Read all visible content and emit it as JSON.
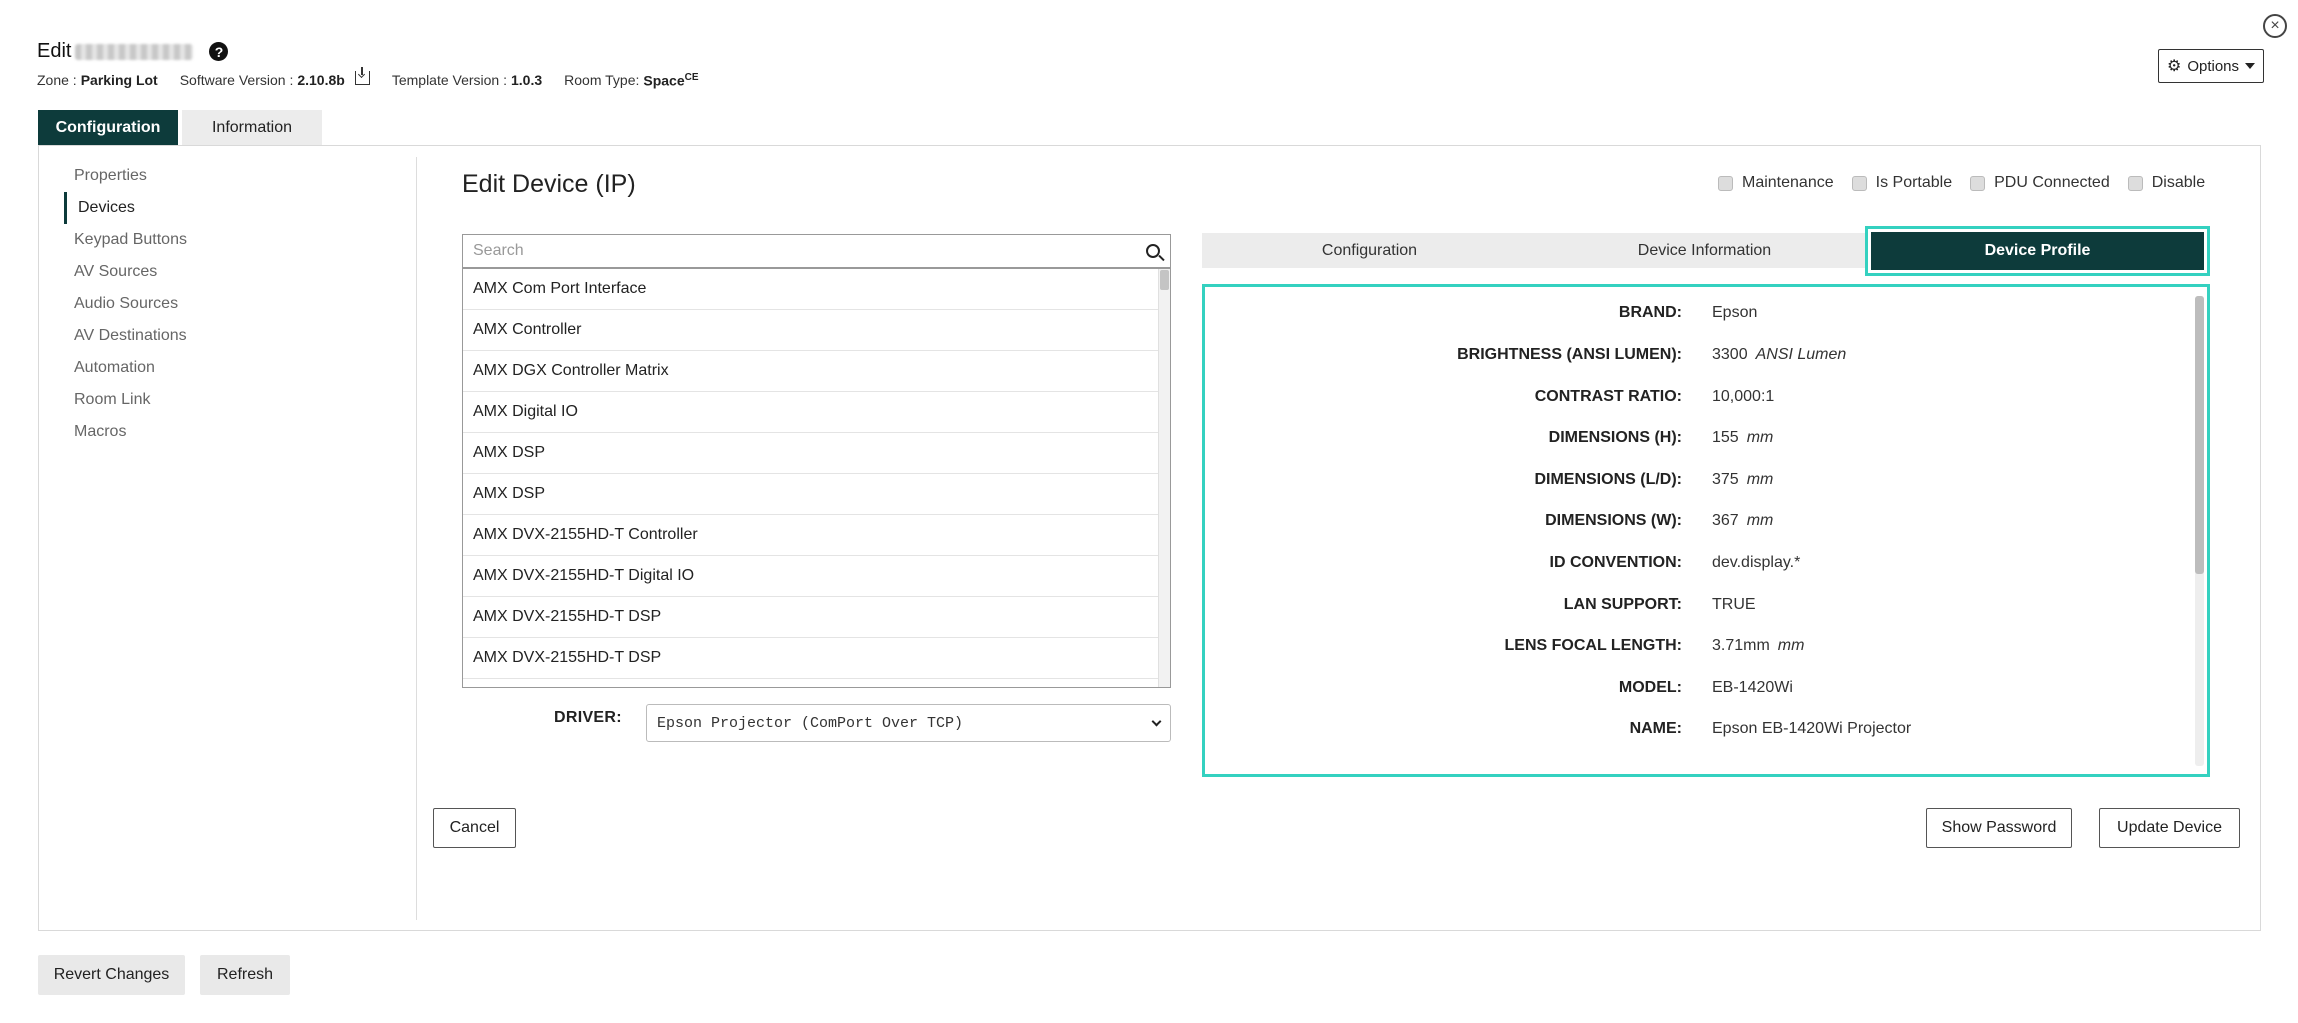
{
  "header": {
    "edit_prefix": "Edit",
    "help_icon": "?",
    "zone_label": "Zone :",
    "zone_value": "Parking Lot",
    "software_label": "Software Version :",
    "software_value": "2.10.8b",
    "template_label": "Template Version :",
    "template_value": "1.0.3",
    "roomtype_label": "Room Type:",
    "roomtype_value": "Space",
    "roomtype_sup": "CE",
    "close_icon": "×"
  },
  "options": {
    "label": "Options",
    "icon": "gear-icon"
  },
  "tabs": [
    {
      "label": "Configuration",
      "active": true
    },
    {
      "label": "Information",
      "active": false
    }
  ],
  "sidebar": {
    "items": [
      {
        "label": "Properties"
      },
      {
        "label": "Devices",
        "active": true
      },
      {
        "label": "Keypad Buttons"
      },
      {
        "label": "AV Sources"
      },
      {
        "label": "Audio Sources"
      },
      {
        "label": "AV Destinations"
      },
      {
        "label": "Automation"
      },
      {
        "label": "Room Link"
      },
      {
        "label": "Macros"
      }
    ]
  },
  "main": {
    "title": "Edit Device (IP)",
    "checkboxes": [
      {
        "label": "Maintenance",
        "checked": false
      },
      {
        "label": "Is Portable",
        "checked": false
      },
      {
        "label": "PDU Connected",
        "checked": false
      },
      {
        "label": "Disable",
        "checked": false
      }
    ],
    "search": {
      "placeholder": "Search",
      "value": ""
    },
    "devices": [
      "AMX Com Port Interface",
      "AMX Controller",
      "AMX DGX Controller Matrix",
      "AMX Digital IO",
      "AMX DSP",
      "AMX DSP",
      "AMX DVX-2155HD-T Controller",
      "AMX DVX-2155HD-T Digital IO",
      "AMX DVX-2155HD-T DSP",
      "AMX DVX-2155HD-T DSP"
    ],
    "driver_label": "DRIVER:",
    "driver_value": "Epson Projector (ComPort Over TCP)"
  },
  "right_tabs": [
    {
      "label": "Configuration",
      "active": false
    },
    {
      "label": "Device Information",
      "active": false
    },
    {
      "label": "Device Profile",
      "active": true
    }
  ],
  "profile": [
    {
      "key": "BRAND:",
      "value": "Epson",
      "unit": ""
    },
    {
      "key": "BRIGHTNESS (ANSI LUMEN):",
      "value": "3300",
      "unit": "ANSI Lumen"
    },
    {
      "key": "CONTRAST RATIO:",
      "value": "10,000:1",
      "unit": ""
    },
    {
      "key": "DIMENSIONS (H):",
      "value": "155",
      "unit": "mm"
    },
    {
      "key": "DIMENSIONS (L/D):",
      "value": "375",
      "unit": "mm"
    },
    {
      "key": "DIMENSIONS (W):",
      "value": "367",
      "unit": "mm"
    },
    {
      "key": "ID CONVENTION:",
      "value": "dev.display.*",
      "unit": ""
    },
    {
      "key": "LAN SUPPORT:",
      "value": "TRUE",
      "unit": ""
    },
    {
      "key": "LENS FOCAL LENGTH:",
      "value": "3.71mm",
      "unit": "mm"
    },
    {
      "key": "MODEL:",
      "value": "EB-1420Wi",
      "unit": ""
    },
    {
      "key": "NAME:",
      "value": "Epson EB-1420Wi Projector",
      "unit": ""
    }
  ],
  "buttons": {
    "cancel": "Cancel",
    "show_password": "Show Password",
    "update_device": "Update Device",
    "revert": "Revert Changes",
    "refresh": "Refresh"
  }
}
